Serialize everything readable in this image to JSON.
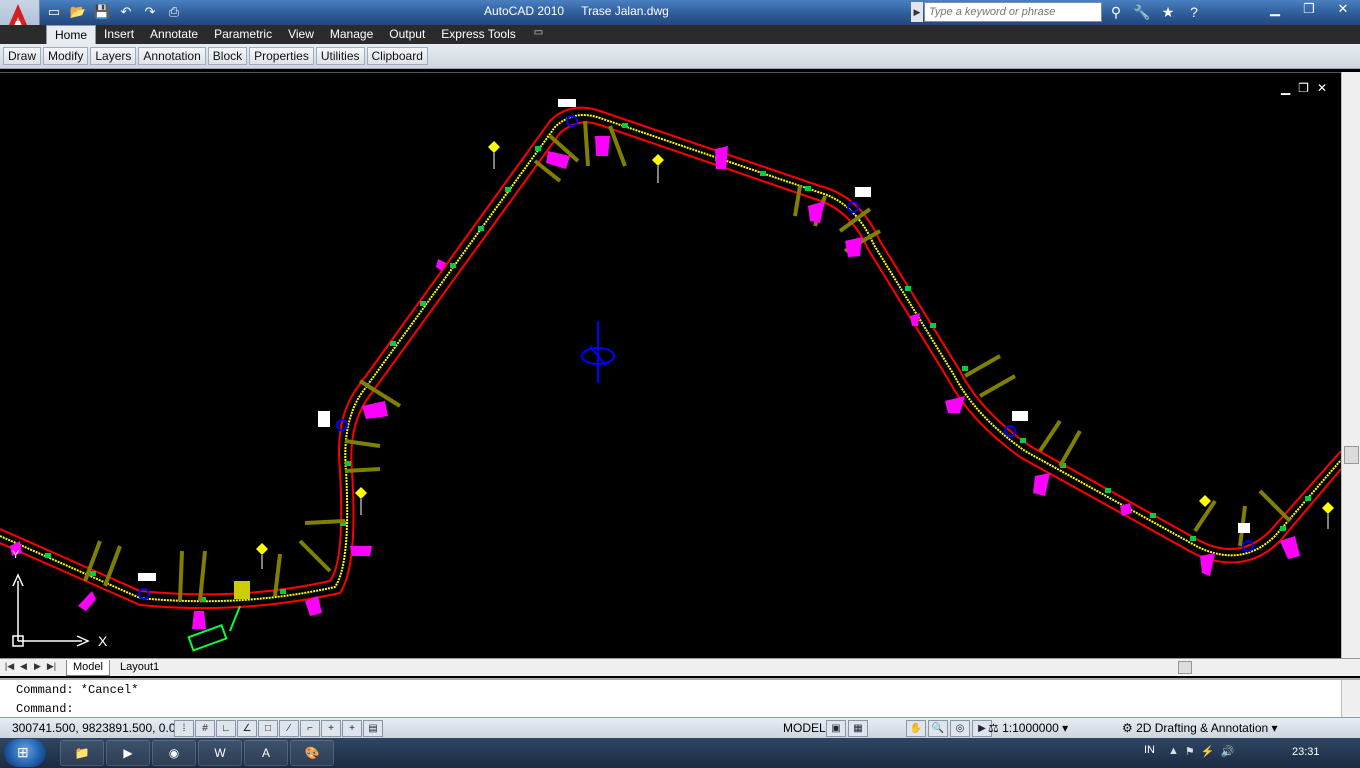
{
  "window": {
    "app_name": "AutoCAD 2010",
    "file_name": "Trase Jalan.dwg",
    "search_placeholder": "Type a keyword or phrase"
  },
  "quick_access": [
    "new-icon",
    "open-icon",
    "save-icon",
    "undo-icon",
    "redo-icon",
    "plot-icon"
  ],
  "ribbon": {
    "tabs": [
      "Home",
      "Insert",
      "Annotate",
      "Parametric",
      "View",
      "Manage",
      "Output",
      "Express Tools"
    ],
    "active_tab": "Home",
    "panels": [
      "Draw",
      "Modify",
      "Layers",
      "Annotation",
      "Block",
      "Properties",
      "Utilities",
      "Clipboard"
    ]
  },
  "drawing": {
    "background": "#000000",
    "road_edge_color": "#ff0000",
    "road_center_color": "#ffff00",
    "station_color": "#00cc44",
    "culvert_color": "#ff00ff",
    "cross_section_color": "#808000",
    "ucs": {
      "x_label": "X",
      "y_label": "Y"
    }
  },
  "layout_tabs": [
    "Model",
    "Layout1"
  ],
  "command_line": {
    "history": "Command: *Cancel*",
    "prompt": "Command:"
  },
  "status_bar": {
    "coordinates": "300741.500, 9823891.500, 0.000",
    "model_label": "MODEL",
    "annotation_scale": "1:1000000",
    "workspace": "2D Drafting & Annotation"
  },
  "taskbar": {
    "language": "IN",
    "time": "23:31"
  }
}
